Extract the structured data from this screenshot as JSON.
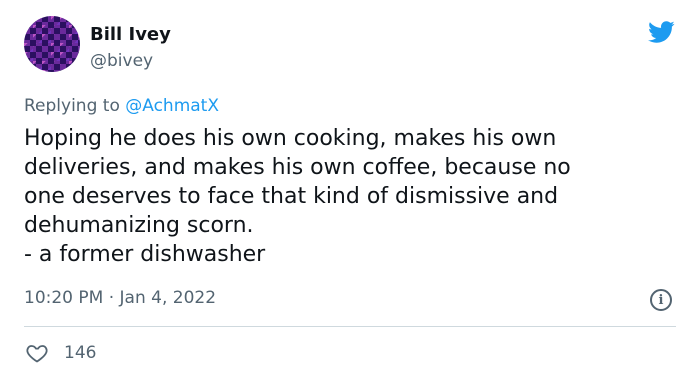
{
  "author": {
    "name": "Bill Ivey",
    "handle": "@bivey"
  },
  "reply": {
    "prefix": "Replying to",
    "mention": "@AchmatX"
  },
  "tweet": {
    "lines": [
      "Hoping he does his own cooking, makes his own",
      "deliveries, and makes his own coffee, because no",
      "one deserves to face that kind of dismissive and",
      "dehumanizing scorn.",
      "- a former dishwasher"
    ]
  },
  "meta": {
    "time": "10:20 PM",
    "separator": "·",
    "date": "Jan 4, 2022"
  },
  "stats": {
    "likes": "146"
  },
  "icons": {
    "brand": "twitter-bird-icon",
    "info": "info-icon",
    "like": "heart-icon"
  },
  "colors": {
    "brand": "#1d9bf0",
    "text": "#0f1419",
    "secondary": "#536471",
    "divider": "#cfd9de"
  }
}
